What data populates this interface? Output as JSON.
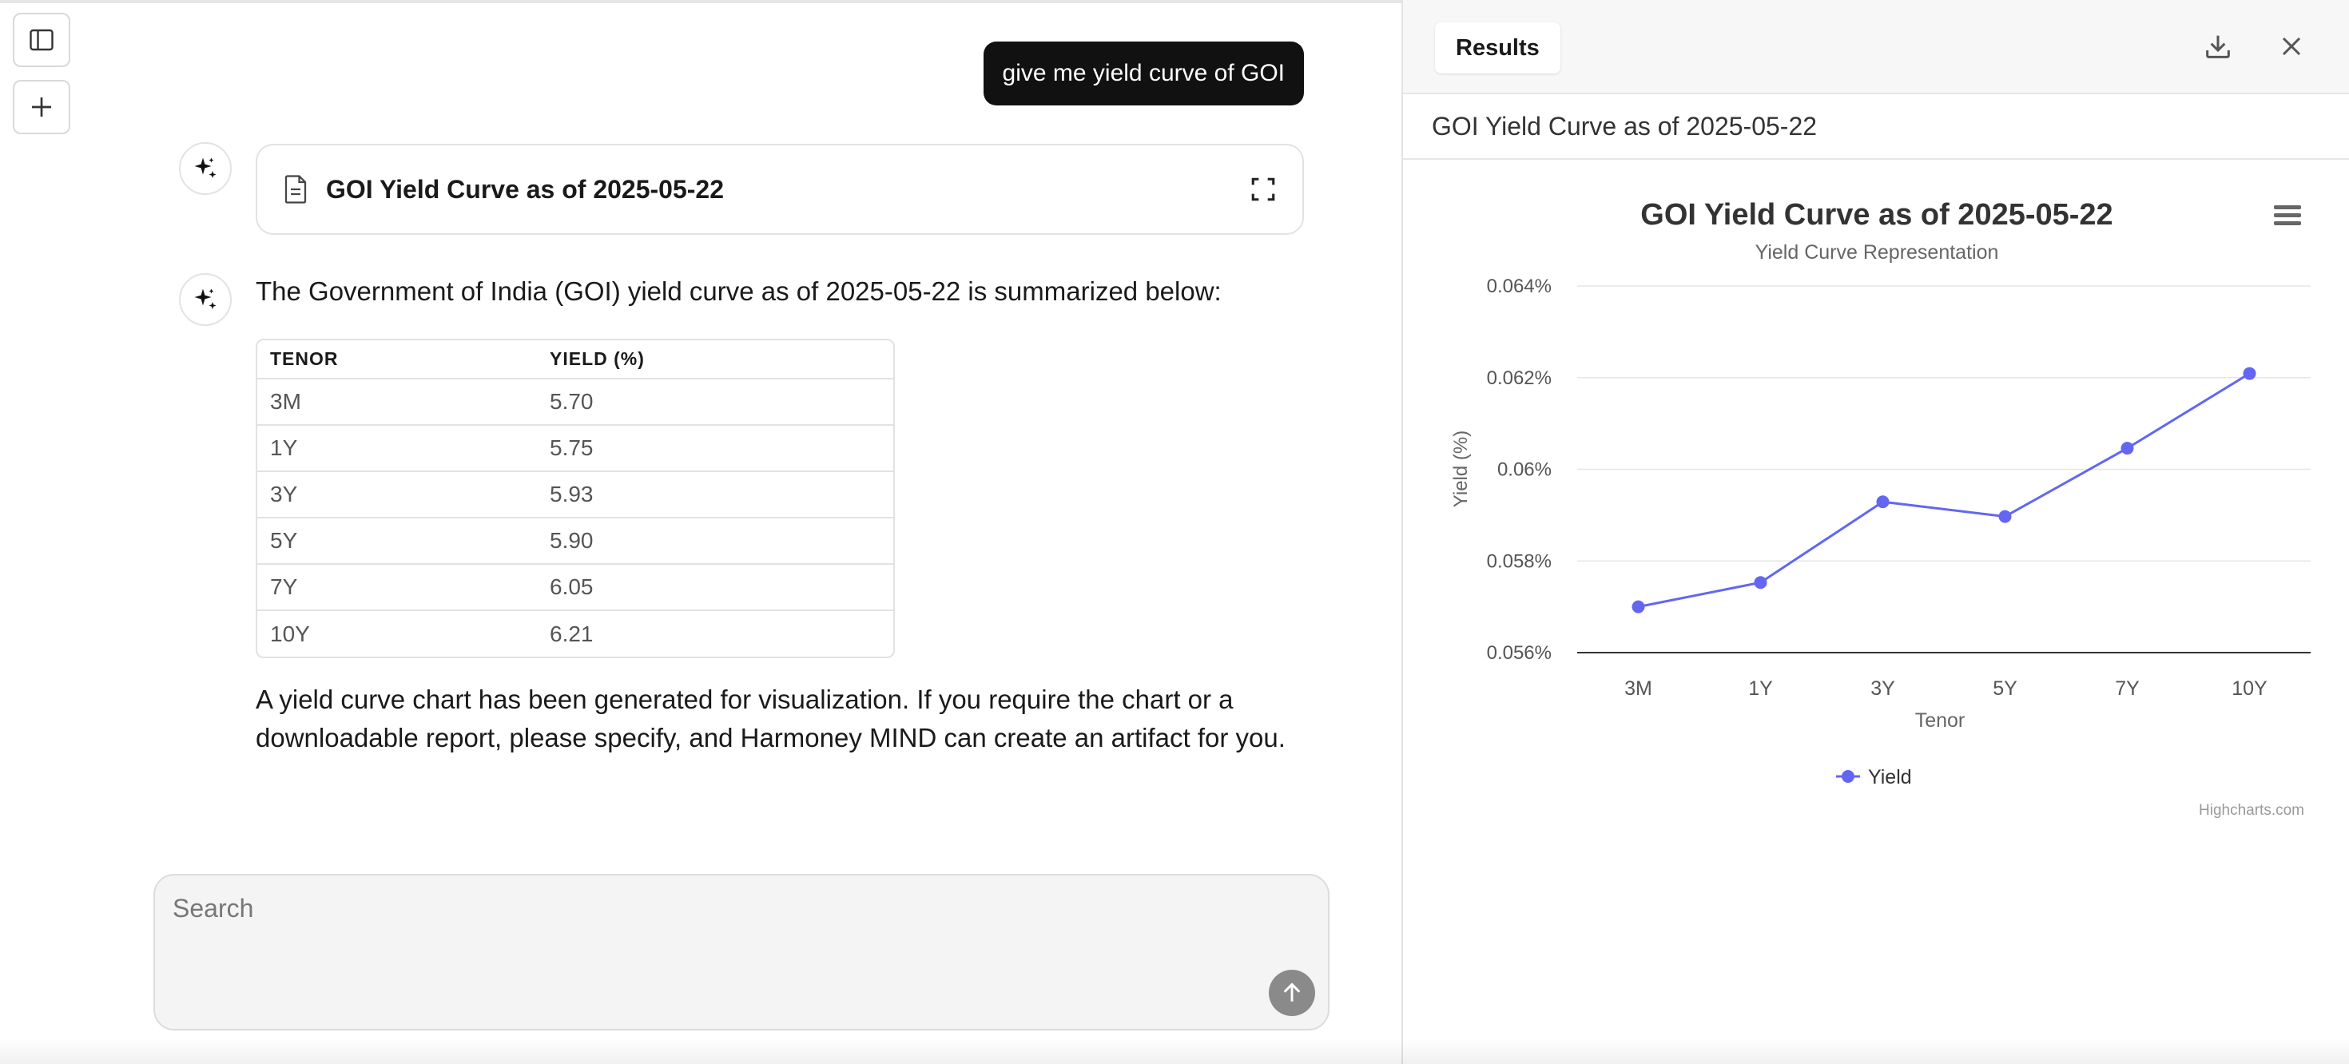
{
  "rail": {
    "sidebar_icon": "sidebar-toggle-icon",
    "new_icon": "plus-icon"
  },
  "chat": {
    "user_message": "give me yield curve of GOI",
    "artifact": {
      "title": "GOI Yield Curve as of 2025-05-22",
      "icon": "document-icon",
      "action_icon": "expand-icon"
    },
    "summary": "The Government of India (GOI) yield curve as of 2025-05-22 is summarized below:",
    "table": {
      "headers": [
        "TENOR",
        "YIELD (%)"
      ],
      "rows": [
        [
          "3M",
          "5.70"
        ],
        [
          "1Y",
          "5.75"
        ],
        [
          "3Y",
          "5.93"
        ],
        [
          "5Y",
          "5.90"
        ],
        [
          "7Y",
          "6.05"
        ],
        [
          "10Y",
          "6.21"
        ]
      ]
    },
    "note": "A yield curve chart has been generated for visualization. If you require the chart or a downloadable report, please specify, and Harmoney MIND can create an artifact for you.",
    "search": {
      "placeholder": "Search",
      "value": ""
    }
  },
  "panel": {
    "tab_label": "Results",
    "title": "GOI Yield Curve as of 2025-05-22",
    "download_icon": "download-icon",
    "close_icon": "close-icon"
  },
  "chart_data": {
    "type": "line",
    "title": "GOI Yield Curve as of 2025-05-22",
    "subtitle": "Yield Curve Representation",
    "xlabel": "Tenor",
    "ylabel": "Yield (%)",
    "categories": [
      "3M",
      "1Y",
      "3Y",
      "5Y",
      "7Y",
      "10Y"
    ],
    "series": [
      {
        "name": "Yield",
        "values": [
          0.057,
          0.05753,
          0.05929,
          0.05897,
          0.06046,
          0.06209
        ],
        "color": "#6366f1"
      }
    ],
    "ylim": [
      0.056,
      0.064
    ],
    "yticks": [
      "0.056%",
      "0.058%",
      "0.06%",
      "0.062%",
      "0.064%"
    ],
    "ytick_values": [
      0.056,
      0.058,
      0.06,
      0.062,
      0.064
    ],
    "grid": true,
    "legend": "bottom-center",
    "credits": "Highcharts.com"
  },
  "colors": {
    "accent": "#6366f1",
    "user_bubble": "#111111",
    "send_button": "#8a8a8a"
  }
}
